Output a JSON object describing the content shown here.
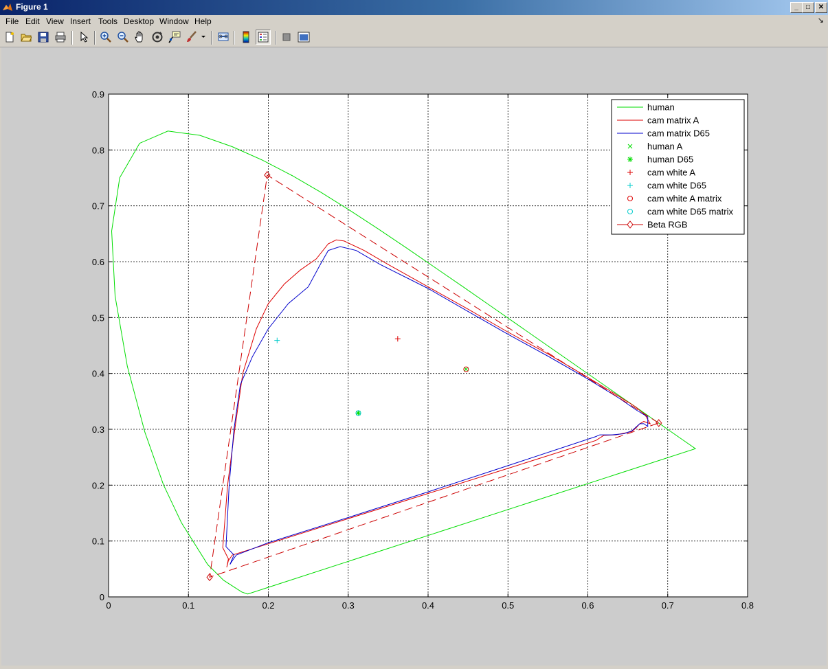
{
  "window": {
    "title": "Figure 1",
    "minimize": "_",
    "maximize": "□",
    "close": "✕"
  },
  "menu": [
    "File",
    "Edit",
    "View",
    "Insert",
    "Tools",
    "Desktop",
    "Window",
    "Help"
  ],
  "toolbar_icons": [
    "new-figure-icon",
    "open-file-icon",
    "save-icon",
    "print-icon",
    "edit-plot-arrow-icon",
    "zoom-in-icon",
    "zoom-out-icon",
    "pan-hand-icon",
    "rotate-3d-icon",
    "data-cursor-icon",
    "brush-icon",
    "link-plot-icon",
    "colorbar-icon",
    "legend-icon",
    "hide-plot-tools-icon",
    "show-plot-tools-icon"
  ],
  "colors": {
    "human": "#00dd00",
    "camA": "#dd0000",
    "camD65": "#0000cc",
    "cyan": "#00cccc",
    "beta": "#cc0000"
  },
  "chart_data": {
    "type": "line",
    "title": "",
    "xlabel": "",
    "ylabel": "",
    "xlim": [
      0,
      0.8
    ],
    "ylim": [
      0,
      0.9
    ],
    "xticks": [
      "0",
      "0.1",
      "0.2",
      "0.3",
      "0.4",
      "0.5",
      "0.6",
      "0.7",
      "0.8"
    ],
    "yticks": [
      "0",
      "0.1",
      "0.2",
      "0.3",
      "0.4",
      "0.5",
      "0.6",
      "0.7",
      "0.8",
      "0.9"
    ],
    "grid": true,
    "legend_position": "top-right",
    "legend": [
      "human",
      "cam matrix A",
      "cam matrix D65",
      "human A",
      "human D65",
      "cam white A",
      "cam white D65",
      "cam white A matrix",
      "cam white D65 matrix",
      "Beta RGB"
    ],
    "series": [
      {
        "name": "human",
        "style": "solid",
        "color": "#00dd00",
        "points": [
          [
            0.1741,
            0.005
          ],
          [
            0.1666,
            0.0089
          ],
          [
            0.144,
            0.0297
          ],
          [
            0.1241,
            0.0578
          ],
          [
            0.0913,
            0.1327
          ],
          [
            0.0687,
            0.2007
          ],
          [
            0.0454,
            0.295
          ],
          [
            0.0235,
            0.4127
          ],
          [
            0.0082,
            0.5384
          ],
          [
            0.0039,
            0.6548
          ],
          [
            0.0139,
            0.7502
          ],
          [
            0.0389,
            0.812
          ],
          [
            0.0743,
            0.8338
          ],
          [
            0.1142,
            0.8262
          ],
          [
            0.1547,
            0.8059
          ],
          [
            0.1929,
            0.7816
          ],
          [
            0.2296,
            0.7543
          ],
          [
            0.2658,
            0.7243
          ],
          [
            0.3016,
            0.6923
          ],
          [
            0.3373,
            0.6589
          ],
          [
            0.3731,
            0.6245
          ],
          [
            0.4087,
            0.5896
          ],
          [
            0.4441,
            0.5547
          ],
          [
            0.4788,
            0.5202
          ],
          [
            0.5125,
            0.4866
          ],
          [
            0.5448,
            0.4544
          ],
          [
            0.5752,
            0.4242
          ],
          [
            0.6029,
            0.3965
          ],
          [
            0.627,
            0.3725
          ],
          [
            0.6482,
            0.3514
          ],
          [
            0.6658,
            0.334
          ],
          [
            0.6801,
            0.3197
          ],
          [
            0.6915,
            0.3083
          ],
          [
            0.7006,
            0.2993
          ],
          [
            0.714,
            0.2859
          ],
          [
            0.7347,
            0.2653
          ],
          [
            0.1741,
            0.005
          ]
        ]
      },
      {
        "name": "cam matrix A",
        "style": "solid",
        "color": "#dd0000",
        "points": [
          [
            0.148,
            0.053
          ],
          [
            0.15,
            0.068
          ],
          [
            0.143,
            0.088
          ],
          [
            0.149,
            0.2
          ],
          [
            0.158,
            0.3
          ],
          [
            0.168,
            0.4
          ],
          [
            0.185,
            0.48
          ],
          [
            0.2,
            0.525
          ],
          [
            0.22,
            0.56
          ],
          [
            0.24,
            0.585
          ],
          [
            0.26,
            0.605
          ],
          [
            0.275,
            0.632
          ],
          [
            0.285,
            0.639
          ],
          [
            0.295,
            0.637
          ],
          [
            0.32,
            0.62
          ],
          [
            0.35,
            0.595
          ],
          [
            0.4,
            0.555
          ],
          [
            0.45,
            0.515
          ],
          [
            0.5,
            0.474
          ],
          [
            0.55,
            0.435
          ],
          [
            0.6,
            0.393
          ],
          [
            0.64,
            0.358
          ],
          [
            0.66,
            0.34
          ],
          [
            0.672,
            0.325
          ],
          [
            0.678,
            0.31
          ],
          [
            0.67,
            0.314
          ],
          [
            0.665,
            0.31
          ],
          [
            0.66,
            0.302
          ],
          [
            0.655,
            0.296
          ],
          [
            0.645,
            0.293
          ],
          [
            0.635,
            0.29
          ],
          [
            0.62,
            0.289
          ],
          [
            0.61,
            0.28
          ],
          [
            0.5,
            0.23
          ],
          [
            0.4,
            0.185
          ],
          [
            0.3,
            0.14
          ],
          [
            0.2,
            0.095
          ],
          [
            0.155,
            0.075
          ],
          [
            0.15,
            0.065
          ],
          [
            0.148,
            0.053
          ]
        ]
      },
      {
        "name": "cam matrix D65",
        "style": "solid",
        "color": "#0000cc",
        "points": [
          [
            0.152,
            0.058
          ],
          [
            0.157,
            0.075
          ],
          [
            0.147,
            0.09
          ],
          [
            0.151,
            0.2
          ],
          [
            0.157,
            0.3
          ],
          [
            0.165,
            0.38
          ],
          [
            0.18,
            0.43
          ],
          [
            0.2,
            0.48
          ],
          [
            0.225,
            0.525
          ],
          [
            0.25,
            0.555
          ],
          [
            0.265,
            0.595
          ],
          [
            0.275,
            0.62
          ],
          [
            0.29,
            0.627
          ],
          [
            0.31,
            0.62
          ],
          [
            0.34,
            0.595
          ],
          [
            0.4,
            0.552
          ],
          [
            0.45,
            0.511
          ],
          [
            0.5,
            0.47
          ],
          [
            0.55,
            0.431
          ],
          [
            0.6,
            0.39
          ],
          [
            0.64,
            0.355
          ],
          [
            0.66,
            0.335
          ],
          [
            0.675,
            0.322
          ],
          [
            0.675,
            0.305
          ],
          [
            0.67,
            0.31
          ],
          [
            0.665,
            0.31
          ],
          [
            0.655,
            0.297
          ],
          [
            0.645,
            0.292
          ],
          [
            0.63,
            0.29
          ],
          [
            0.615,
            0.29
          ],
          [
            0.61,
            0.287
          ],
          [
            0.5,
            0.235
          ],
          [
            0.4,
            0.188
          ],
          [
            0.3,
            0.142
          ],
          [
            0.2,
            0.097
          ],
          [
            0.16,
            0.075
          ],
          [
            0.155,
            0.065
          ],
          [
            0.152,
            0.058
          ]
        ]
      },
      {
        "name": "Beta RGB",
        "style": "dashed",
        "color": "#cc0000",
        "marker": "diamond",
        "points": [
          [
            0.6888,
            0.3112
          ],
          [
            0.1986,
            0.7551
          ],
          [
            0.1265,
            0.0352
          ],
          [
            0.6888,
            0.3112
          ]
        ]
      }
    ],
    "points": [
      {
        "name": "human A",
        "marker": "x",
        "color": "#00dd00",
        "x": 0.4476,
        "y": 0.4074
      },
      {
        "name": "human D65",
        "marker": "*",
        "color": "#00dd00",
        "x": 0.3127,
        "y": 0.329
      },
      {
        "name": "cam white A",
        "marker": "+",
        "color": "#dd0000",
        "x": 0.362,
        "y": 0.462
      },
      {
        "name": "cam white D65",
        "marker": "+",
        "color": "#00cccc",
        "x": 0.211,
        "y": 0.459
      },
      {
        "name": "cam white A matrix",
        "marker": "o",
        "color": "#dd0000",
        "x": 0.4476,
        "y": 0.4074
      },
      {
        "name": "cam white D65 matrix",
        "marker": "o",
        "color": "#00cccc",
        "x": 0.3127,
        "y": 0.329
      }
    ]
  }
}
